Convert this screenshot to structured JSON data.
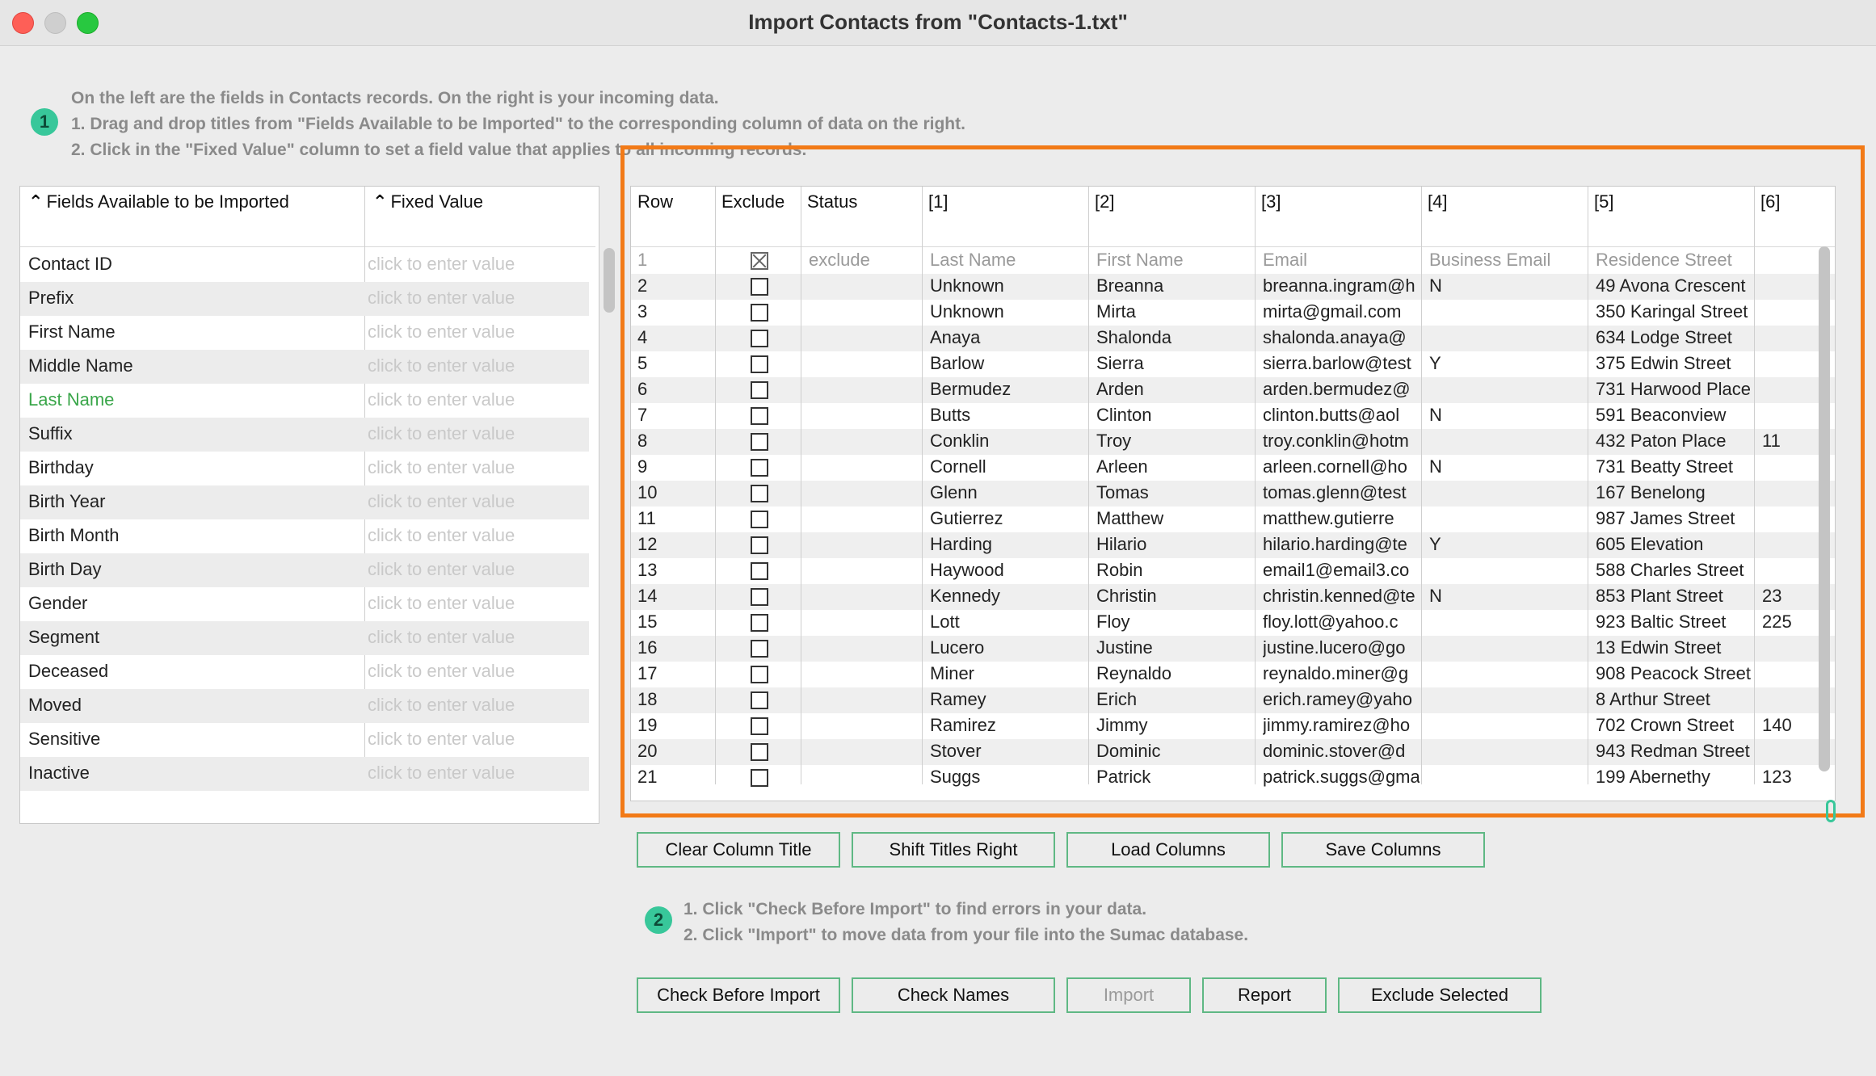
{
  "window": {
    "title": "Import Contacts from \"Contacts-1.txt\""
  },
  "instructions1": {
    "badge": "1",
    "lines": [
      "On the left are the fields in Contacts records. On the right is your incoming data.",
      "1. Drag and drop titles from \"Fields Available to be Imported\" to the corresponding column of data on the right.",
      "2. Click in the \"Fixed Value\" column to set a field value that applies to all incoming records."
    ]
  },
  "left_table": {
    "headers": [
      "Fields Available to be Imported",
      "Fixed Value"
    ],
    "placeholder": "click to enter value",
    "fields": [
      "Contact ID",
      "Prefix",
      "First Name",
      "Middle Name",
      "Last Name",
      "Suffix",
      "Birthday",
      "Birth Year",
      "Birth Month",
      "Birth Day",
      "Gender",
      "Segment",
      "Deceased",
      "Moved",
      "Sensitive",
      "Inactive"
    ],
    "highlighted_field": "Last Name",
    "highlight_color": "#3aa64a"
  },
  "right_table": {
    "headers": [
      "Row",
      "Exclude",
      "Status",
      "[1]",
      "[2]",
      "[3]",
      "[4]",
      "[5]",
      "[6]"
    ],
    "rows": [
      {
        "row": "1",
        "exclude": true,
        "status": "exclude",
        "c1": "Last Name",
        "c2": "First Name",
        "c3": "Email",
        "c4": "Business Email",
        "c5": "Residence Street",
        "c6": ""
      },
      {
        "row": "2",
        "exclude": false,
        "status": "",
        "c1": "Unknown",
        "c2": "Breanna",
        "c3": "breanna.ingram@h",
        "c4": "N",
        "c5": "49 Avona Crescent",
        "c6": ""
      },
      {
        "row": "3",
        "exclude": false,
        "status": "",
        "c1": "Unknown",
        "c2": "Mirta",
        "c3": "mirta@gmail.com",
        "c4": "",
        "c5": "350 Karingal Street",
        "c6": ""
      },
      {
        "row": "4",
        "exclude": false,
        "status": "",
        "c1": "Anaya",
        "c2": "Shalonda",
        "c3": "shalonda.anaya@",
        "c4": "",
        "c5": "634 Lodge Street",
        "c6": ""
      },
      {
        "row": "5",
        "exclude": false,
        "status": "",
        "c1": "Barlow",
        "c2": "Sierra",
        "c3": "sierra.barlow@test",
        "c4": "Y",
        "c5": "375 Edwin Street",
        "c6": ""
      },
      {
        "row": "6",
        "exclude": false,
        "status": "",
        "c1": "Bermudez",
        "c2": "Arden",
        "c3": "arden.bermudez@",
        "c4": "",
        "c5": "731 Harwood Place",
        "c6": ""
      },
      {
        "row": "7",
        "exclude": false,
        "status": "",
        "c1": "Butts",
        "c2": "Clinton",
        "c3": "clinton.butts@aol",
        "c4": "N",
        "c5": "591 Beaconview",
        "c6": ""
      },
      {
        "row": "8",
        "exclude": false,
        "status": "",
        "c1": "Conklin",
        "c2": "Troy",
        "c3": "troy.conklin@hotm",
        "c4": "",
        "c5": "432 Paton Place",
        "c6": "11"
      },
      {
        "row": "9",
        "exclude": false,
        "status": "",
        "c1": "Cornell",
        "c2": "Arleen",
        "c3": "arleen.cornell@ho",
        "c4": "N",
        "c5": "731 Beatty Street",
        "c6": ""
      },
      {
        "row": "10",
        "exclude": false,
        "status": "",
        "c1": "Glenn",
        "c2": "Tomas",
        "c3": "tomas.glenn@test",
        "c4": "",
        "c5": "167 Benelong",
        "c6": ""
      },
      {
        "row": "11",
        "exclude": false,
        "status": "",
        "c1": "Gutierrez",
        "c2": "Matthew",
        "c3": "matthew.gutierre",
        "c4": "",
        "c5": "987 James Street",
        "c6": ""
      },
      {
        "row": "12",
        "exclude": false,
        "status": "",
        "c1": "Harding",
        "c2": "Hilario",
        "c3": "hilario.harding@te",
        "c4": "Y",
        "c5": "605 Elevation",
        "c6": ""
      },
      {
        "row": "13",
        "exclude": false,
        "status": "",
        "c1": "Haywood",
        "c2": "Robin",
        "c3": "email1@email3.co",
        "c4": "",
        "c5": "588 Charles Street",
        "c6": ""
      },
      {
        "row": "14",
        "exclude": false,
        "status": "",
        "c1": "Kennedy",
        "c2": "Christin",
        "c3": "christin.kenned@te",
        "c4": "N",
        "c5": "853 Plant Street",
        "c6": "23"
      },
      {
        "row": "15",
        "exclude": false,
        "status": "",
        "c1": "Lott",
        "c2": "Floy",
        "c3": "floy.lott@yahoo.c",
        "c4": "",
        "c5": "923 Baltic Street",
        "c6": "225"
      },
      {
        "row": "16",
        "exclude": false,
        "status": "",
        "c1": "Lucero",
        "c2": "Justine",
        "c3": "justine.lucero@go",
        "c4": "",
        "c5": "13 Edwin Street",
        "c6": ""
      },
      {
        "row": "17",
        "exclude": false,
        "status": "",
        "c1": "Miner",
        "c2": "Reynaldo",
        "c3": "reynaldo.miner@g",
        "c4": "",
        "c5": "908 Peacock Street",
        "c6": ""
      },
      {
        "row": "18",
        "exclude": false,
        "status": "",
        "c1": "Ramey",
        "c2": "Erich",
        "c3": "erich.ramey@yaho",
        "c4": "",
        "c5": "8 Arthur Street",
        "c6": ""
      },
      {
        "row": "19",
        "exclude": false,
        "status": "",
        "c1": "Ramirez",
        "c2": "Jimmy",
        "c3": "jimmy.ramirez@ho",
        "c4": "",
        "c5": "702 Crown Street",
        "c6": "140"
      },
      {
        "row": "20",
        "exclude": false,
        "status": "",
        "c1": "Stover",
        "c2": "Dominic",
        "c3": "dominic.stover@d",
        "c4": "",
        "c5": "943 Redman Street",
        "c6": ""
      },
      {
        "row": "21",
        "exclude": false,
        "status": "",
        "c1": "Suggs",
        "c2": "Patrick",
        "c3": "patrick.suggs@gma",
        "c4": "",
        "c5": "199 Abernethy",
        "c6": "123"
      }
    ]
  },
  "column_buttons": {
    "clear": "Clear Column Title",
    "shift": "Shift Titles Right",
    "load": "Load Columns",
    "save": "Save Columns"
  },
  "instructions2": {
    "badge": "2",
    "lines": [
      "1. Click \"Check Before Import\" to find errors in your data.",
      "2. Click \"Import\" to move data from your file into the Sumac database."
    ]
  },
  "action_buttons": {
    "check": "Check Before Import",
    "names": "Check Names",
    "import": "Import",
    "report": "Report",
    "exclude": "Exclude Selected"
  },
  "colors": {
    "highlight_border": "#f27a17",
    "button_border": "#5fb884",
    "badge": "#38c79a"
  }
}
